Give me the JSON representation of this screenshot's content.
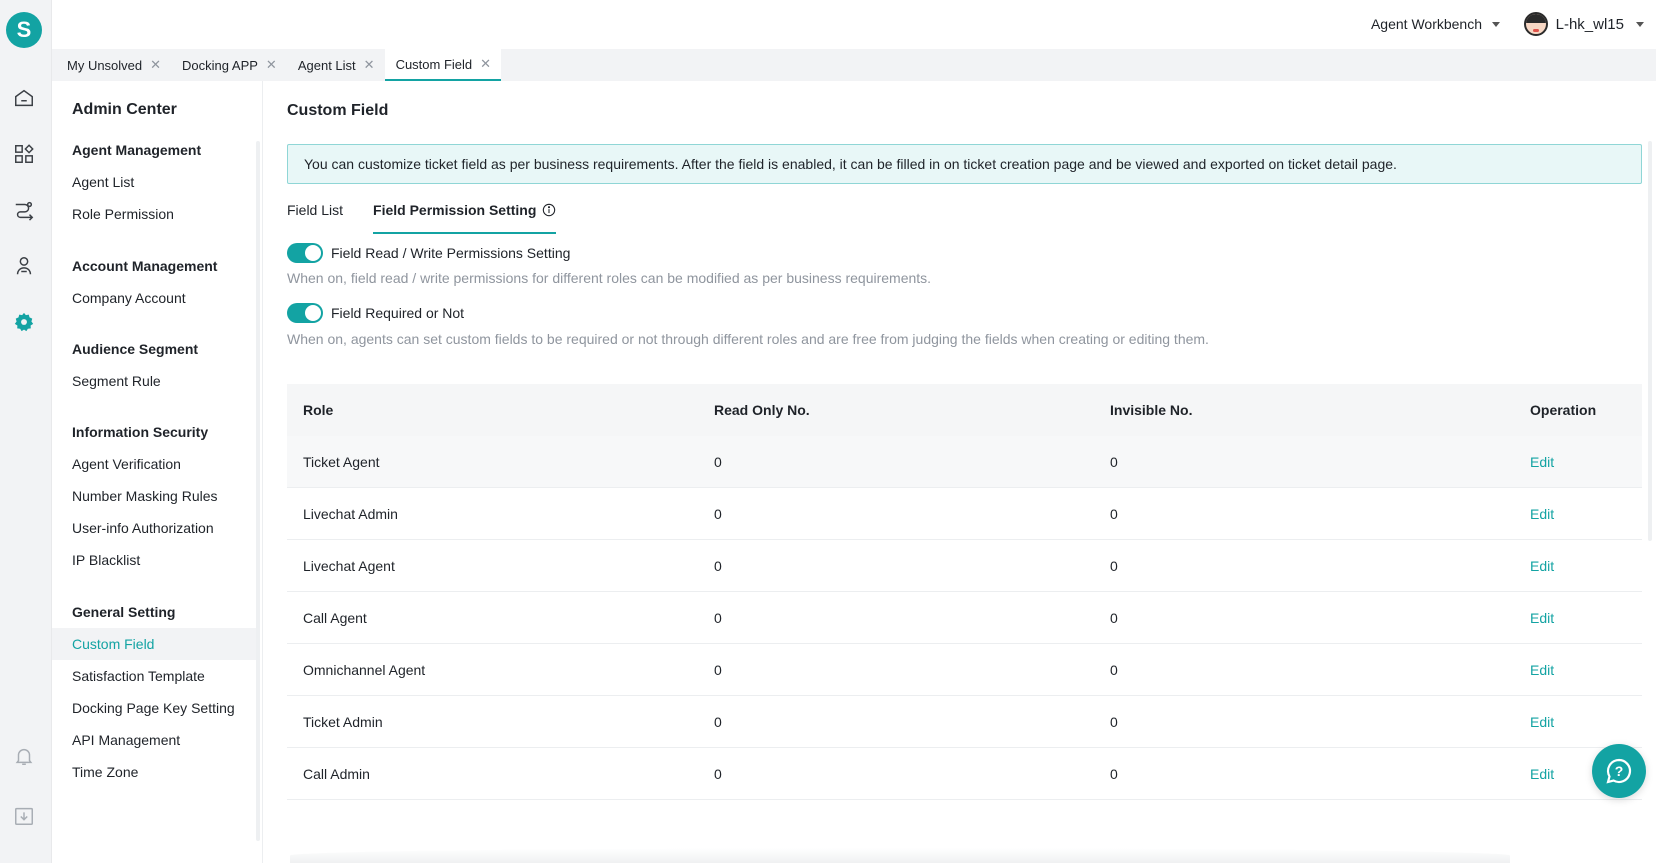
{
  "app": {
    "logo_letter": "S"
  },
  "rail": {
    "icons": [
      "home-icon",
      "apps-grid-icon",
      "routing-icon",
      "customer-icon",
      "settings-icon",
      "bell-icon",
      "download-icon"
    ],
    "active_color": "#13a3a3"
  },
  "header": {
    "workbench_label": "Agent Workbench",
    "username": "L-hk_wl15"
  },
  "page_tabs": [
    {
      "label": "My Unsolved"
    },
    {
      "label": "Docking APP"
    },
    {
      "label": "Agent List"
    },
    {
      "label": "Custom Field",
      "active": true
    }
  ],
  "sidebar": {
    "title": "Admin Center",
    "groups": [
      {
        "title": "Agent Management",
        "items": [
          "Agent List",
          "Role Permission"
        ]
      },
      {
        "title": "Account Management",
        "items": [
          "Company Account"
        ]
      },
      {
        "title": "Audience Segment",
        "items": [
          "Segment Rule"
        ]
      },
      {
        "title": "Information Security",
        "items": [
          "Agent Verification",
          "Number Masking Rules",
          "User-info Authorization",
          "IP Blacklist"
        ]
      },
      {
        "title": "General Setting",
        "items": [
          "Custom Field",
          "Satisfaction Template",
          "Docking Page Key Setting",
          "API Management",
          "Time Zone"
        ]
      }
    ],
    "active_item": "Custom Field"
  },
  "main": {
    "title": "Custom Field",
    "notice": "You can customize ticket field as per business requirements. After the field is enabled, it can be filled in on ticket creation page and be viewed and exported on ticket detail page.",
    "tabs": [
      {
        "label": "Field List"
      },
      {
        "label": "Field Permission Setting",
        "active": true
      }
    ],
    "toggles": [
      {
        "label": "Field Read / Write Permissions Setting",
        "on": true,
        "hint": "When on, field read / write permissions for different roles can be modified as per business requirements."
      },
      {
        "label": "Field Required or Not",
        "on": true,
        "hint": "When on, agents can set custom fields to be required or not through different roles and are free from judging the fields when creating or editing them."
      }
    ],
    "table": {
      "headers": [
        "Role",
        "Read Only No.",
        "Invisible No.",
        "Operation"
      ],
      "rows": [
        {
          "role": "Ticket Agent",
          "read_only": "0",
          "invisible": "0",
          "op": "Edit"
        },
        {
          "role": "Livechat Admin",
          "read_only": "0",
          "invisible": "0",
          "op": "Edit"
        },
        {
          "role": "Livechat Agent",
          "read_only": "0",
          "invisible": "0",
          "op": "Edit"
        },
        {
          "role": "Call Agent",
          "read_only": "0",
          "invisible": "0",
          "op": "Edit"
        },
        {
          "role": "Omnichannel Agent",
          "read_only": "0",
          "invisible": "0",
          "op": "Edit"
        },
        {
          "role": "Ticket Admin",
          "read_only": "0",
          "invisible": "0",
          "op": "Edit"
        },
        {
          "role": "Call Admin",
          "read_only": "0",
          "invisible": "0",
          "op": "Edit"
        }
      ]
    }
  }
}
